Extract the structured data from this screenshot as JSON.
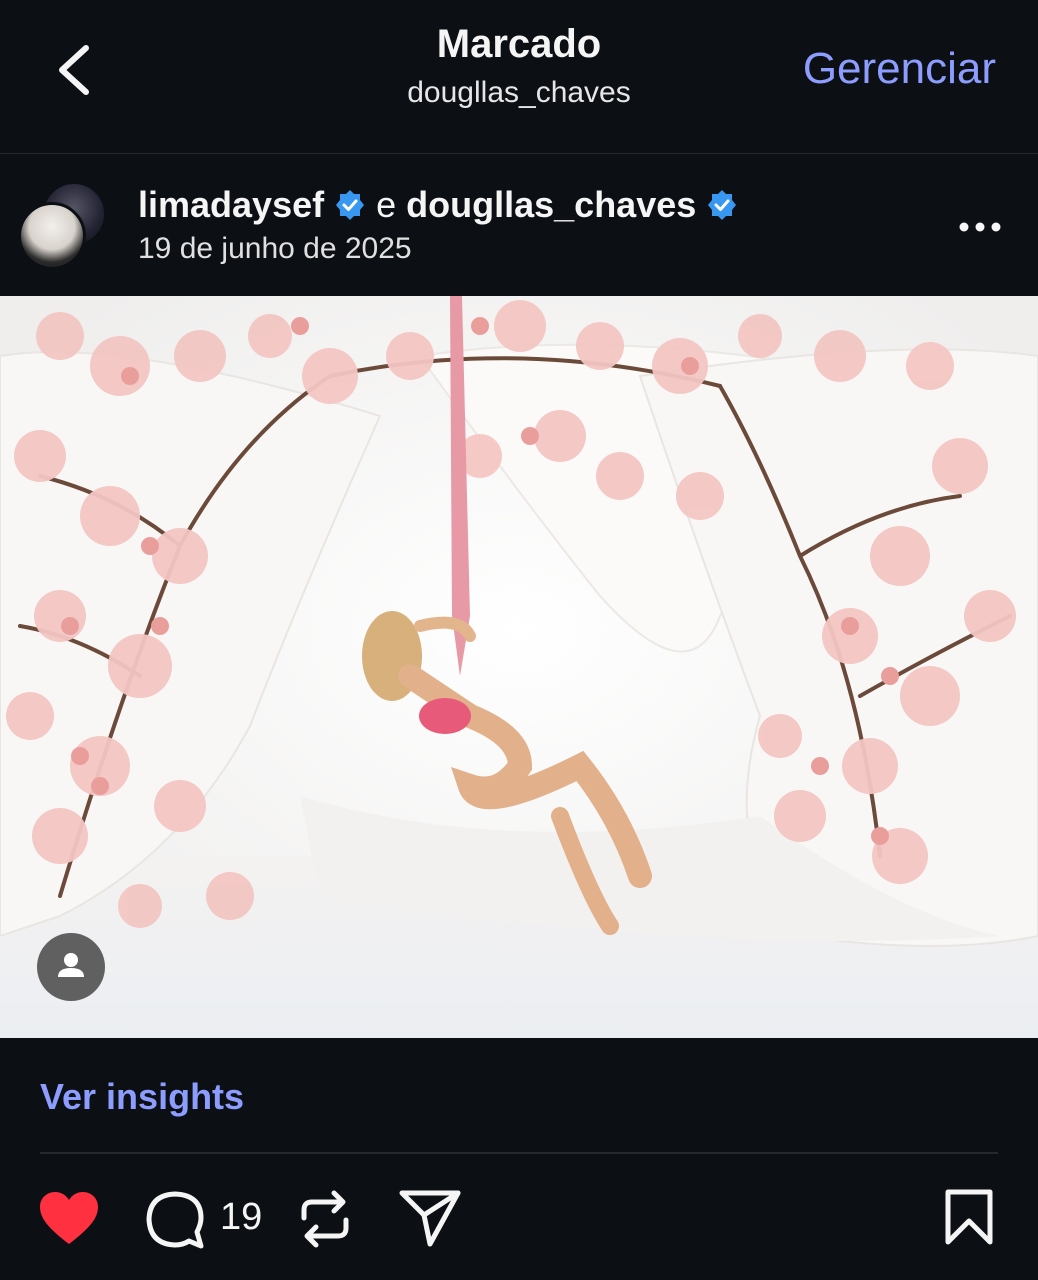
{
  "header": {
    "title": "Marcado",
    "subtitle": "dougllas_chaves",
    "manage_label": "Gerenciar"
  },
  "post": {
    "user1": "limadaysef",
    "connector": "e",
    "user2": "dougllas_chaves",
    "date": "19 de junho de 2025",
    "verified_color": "#3897f0"
  },
  "insights_label": "Ver insights",
  "actions": {
    "liked": true,
    "like_color": "#ff3040",
    "comment_count": "19"
  },
  "icons": [
    "back-chevron-icon",
    "verified-badge-icon",
    "more-options-icon",
    "person-tag-icon",
    "heart-icon",
    "comment-icon",
    "repost-icon",
    "share-icon",
    "bookmark-icon"
  ]
}
